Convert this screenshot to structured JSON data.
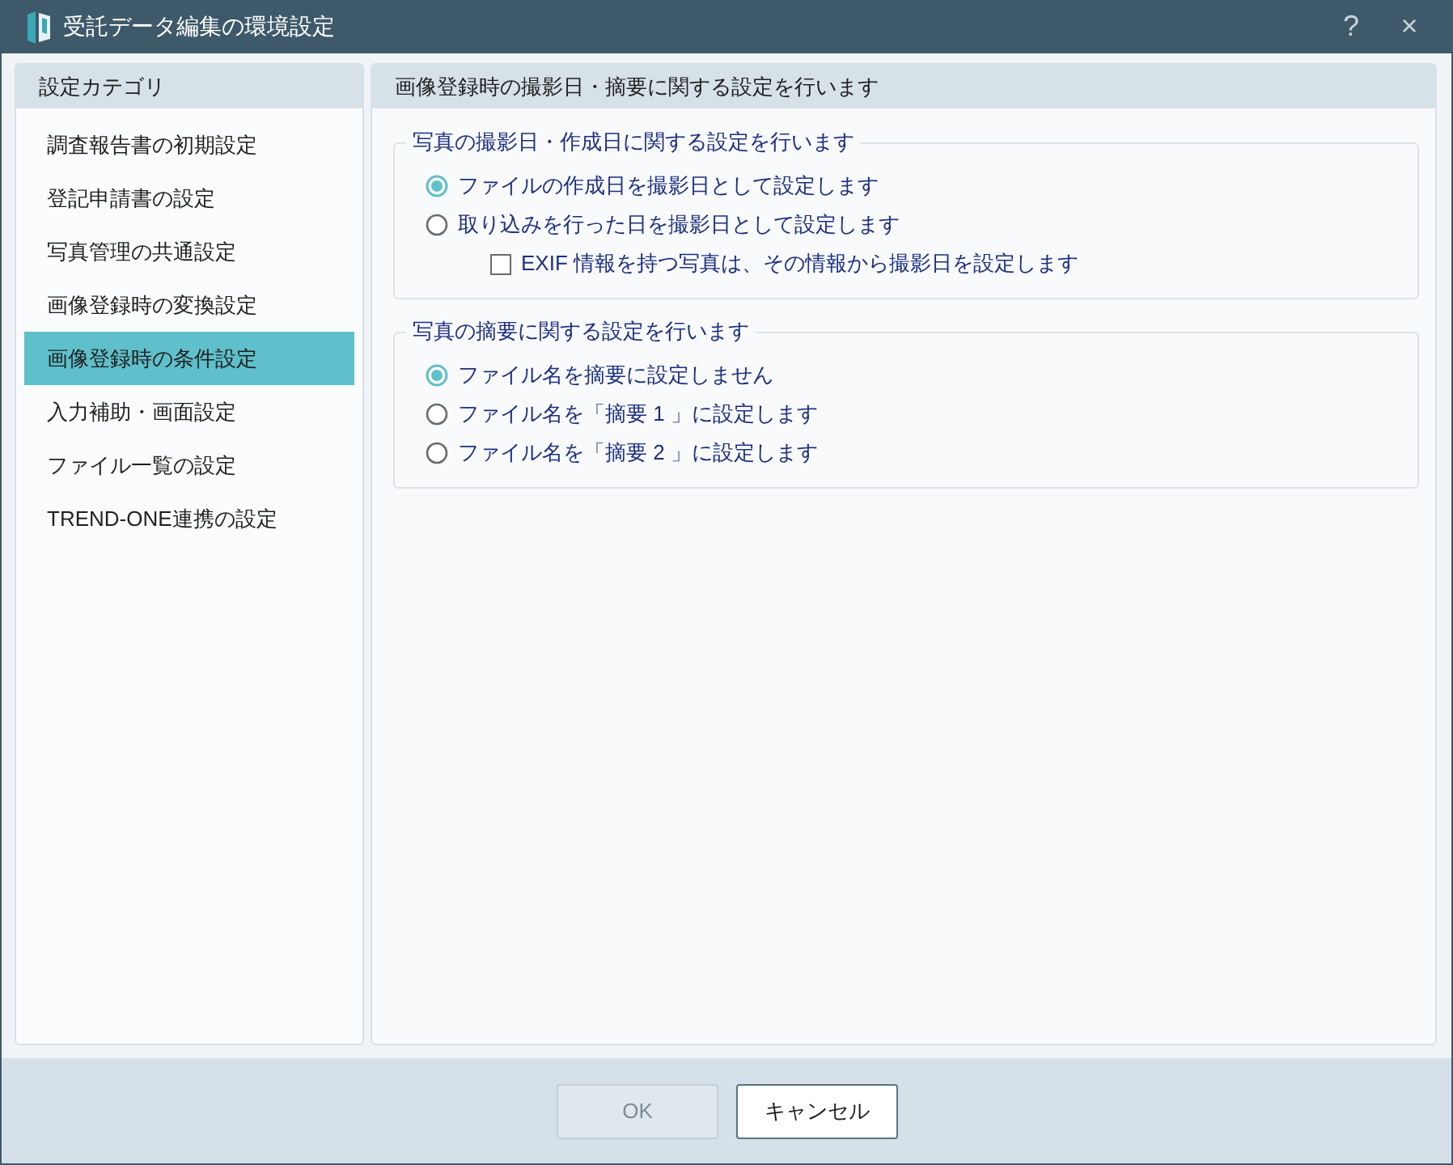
{
  "window": {
    "title": "受託データ編集の環境設定",
    "controls": [
      "?",
      "×"
    ]
  },
  "sidebar": {
    "title": "設定カテゴリ",
    "items": [
      {
        "label": "調査報告書の初期設定",
        "selected": false
      },
      {
        "label": "登記申請書の設定",
        "selected": false
      },
      {
        "label": "写真管理の共通設定",
        "selected": false
      },
      {
        "label": "画像登録時の変換設定",
        "selected": false
      },
      {
        "label": "画像登録時の条件設定",
        "selected": true
      },
      {
        "label": "入力補助・画面設定",
        "selected": false
      },
      {
        "label": "ファイル一覧の設定",
        "selected": false
      },
      {
        "label": "TREND-ONE連携の設定",
        "selected": false
      }
    ]
  },
  "panel": {
    "title": "画像登録時の撮影日・摘要に関する設定を行います",
    "sections": [
      {
        "title": "写真の撮影日・作成日に関する設定を行います",
        "options": [
          {
            "kind": "radio",
            "label": "ファイルの作成日を撮影日として設定します",
            "selected": true
          },
          {
            "kind": "radio",
            "label": "取り込みを行った日を撮影日として設定します",
            "selected": false,
            "children": [
              {
                "kind": "checkbox",
                "label": "EXIF 情報を持つ写真は、その情報から撮影日を設定します",
                "checked": false
              }
            ]
          }
        ]
      },
      {
        "title": "写真の摘要に関する設定を行います",
        "options": [
          {
            "kind": "radio",
            "label": "ファイル名を摘要に設定しません",
            "selected": true
          },
          {
            "kind": "radio",
            "label": "ファイル名を「摘要 1 」に設定します",
            "selected": false
          },
          {
            "kind": "radio",
            "label": "ファイル名を「摘要 2 」に設定します",
            "selected": false
          }
        ]
      }
    ]
  },
  "buttons": [
    {
      "label": "OK",
      "disabled": true
    },
    {
      "label": "キャンセル",
      "disabled": false
    }
  ]
}
